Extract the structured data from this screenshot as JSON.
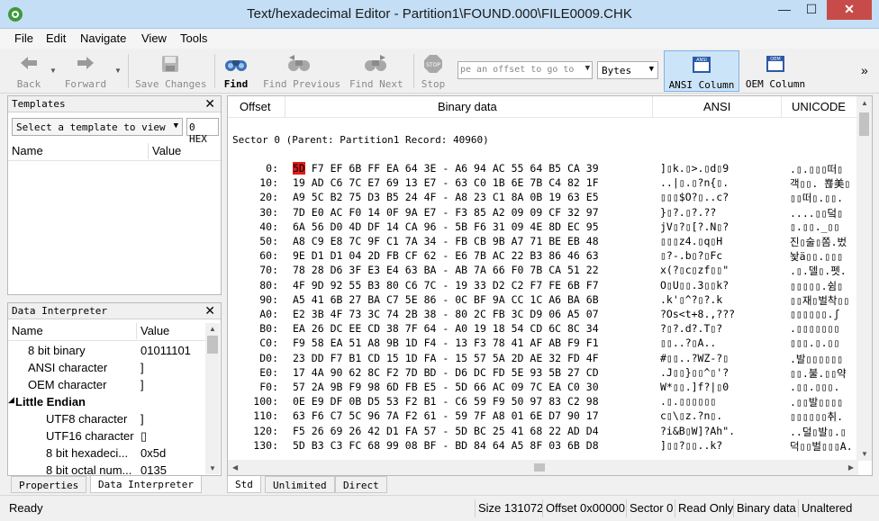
{
  "window": {
    "title": "Text/hexadecimal Editor - Partition1\\FOUND.000\\FILE0009.CHK",
    "minimize": "—",
    "maximize": "☐",
    "close": "✕"
  },
  "menu": [
    "File",
    "Edit",
    "Navigate",
    "View",
    "Tools"
  ],
  "toolbar": {
    "back": "Back",
    "forward": "Forward",
    "save_changes": "Save Changes",
    "find": "Find",
    "find_previous": "Find Previous",
    "find_next": "Find Next",
    "stop": "Stop",
    "offset_placeholder": "pe an offset to go to",
    "bytes_select": "Bytes",
    "ansi_column": "ANSI Column",
    "oem_column": "OEM Column",
    "overflow": "»"
  },
  "templates_pane": {
    "title": "Templates",
    "select_placeholder": "Select a template to view",
    "hex_value": "0 HEX",
    "col_name": "Name",
    "col_value": "Value"
  },
  "data_interpreter": {
    "title": "Data Interpreter",
    "col_name": "Name",
    "col_value": "Value",
    "rows": [
      {
        "name": "8 bit binary",
        "value": "01011101",
        "indent": 1
      },
      {
        "name": "ANSI character",
        "value": "]",
        "indent": 1
      },
      {
        "name": "OEM character",
        "value": "]",
        "indent": 1
      },
      {
        "name": "Little Endian",
        "value": "",
        "indent": 0,
        "group": true
      },
      {
        "name": "UTF8 character",
        "value": "]",
        "indent": 2
      },
      {
        "name": "UTF16 character",
        "value": "▯",
        "indent": 2
      },
      {
        "name": "8 bit hexadeci...",
        "value": "0x5d",
        "indent": 2
      },
      {
        "name": "8 bit octal num...",
        "value": "0135",
        "indent": 2
      }
    ]
  },
  "left_tabs": [
    "Properties",
    "Data Interpreter"
  ],
  "hex_view": {
    "col_offset": "Offset",
    "col_binary": "Binary data",
    "col_ansi": "ANSI",
    "col_unicode": "UNICODE",
    "sector_line": "Sector 0 (Parent: Partition1 Record: 40960)",
    "rows": [
      {
        "off": "0:",
        "b": [
          "5D",
          "F7",
          "EF",
          "6B",
          "FF",
          "EA",
          "64",
          "3E",
          "A6",
          "94",
          "AC",
          "55",
          "64",
          "B5",
          "CA",
          "39"
        ],
        "a": "]▯k.▯>.▯d▯9",
        "u": ".▯.▯▯▯떠▯"
      },
      {
        "off": "10:",
        "b": [
          "19",
          "AD",
          "C6",
          "7C",
          "E7",
          "69",
          "13",
          "E7",
          "63",
          "C0",
          "1B",
          "6E",
          "7B",
          "C4",
          "82",
          "1F"
        ],
        "a": "..|▯.▯?n{▯.",
        "u": "객▯▯. 뾶美▯"
      },
      {
        "off": "20:",
        "b": [
          "A9",
          "5C",
          "B2",
          "75",
          "D3",
          "B5",
          "24",
          "4F",
          "A8",
          "23",
          "C1",
          "8A",
          "0B",
          "19",
          "63",
          "E5"
        ],
        "a": "▯▯▯$O?▯..c?",
        "u": "▯▯떠▯.▯▯."
      },
      {
        "off": "30:",
        "b": [
          "7D",
          "E0",
          "AC",
          "F0",
          "14",
          "0F",
          "9A",
          "E7",
          "F3",
          "85",
          "A2",
          "09",
          "09",
          "CF",
          "32",
          "97"
        ],
        "a": "}▯?.▯?.??",
        "u": "....▯▯덬▯"
      },
      {
        "off": "40:",
        "b": [
          "6A",
          "56",
          "D0",
          "4D",
          "DF",
          "14",
          "CA",
          "96",
          "5B",
          "F6",
          "31",
          "09",
          "4E",
          "8D",
          "EC",
          "95"
        ],
        "a": "jV▯?▯[?.N▯?",
        "u": "▯.▯▯.̲▯▯"
      },
      {
        "off": "50:",
        "b": [
          "A8",
          "C9",
          "E8",
          "7C",
          "9F",
          "C1",
          "7A",
          "34",
          "FB",
          "CB",
          "9B",
          "A7",
          "71",
          "BE",
          "EB",
          "48"
        ],
        "a": "▯▯▯z4.▯q▯H",
        "u": "진▯술▯쫌.벘"
      },
      {
        "off": "60:",
        "b": [
          "9E",
          "D1",
          "D1",
          "04",
          "2D",
          "FB",
          "CF",
          "62",
          "E6",
          "7B",
          "AC",
          "22",
          "B3",
          "86",
          "46",
          "63"
        ],
        "a": "▯?-.b▯?▯Fc",
        "u": "놫ä▯▯.▯▯▯"
      },
      {
        "off": "70:",
        "b": [
          "78",
          "28",
          "D6",
          "3F",
          "E3",
          "E4",
          "63",
          "BA",
          "AB",
          "7A",
          "66",
          "F0",
          "7B",
          "CA",
          "51",
          "22"
        ],
        "a": "x(?▯c▯zf▯▯\"",
        "u": ".▯.델▯.펫."
      },
      {
        "off": "80:",
        "b": [
          "4F",
          "9D",
          "92",
          "55",
          "B3",
          "80",
          "C6",
          "7C",
          "19",
          "33",
          "D2",
          "C2",
          "F7",
          "FE",
          "6B",
          "F7"
        ],
        "a": "O▯U▯▯.3▯▯k?",
        "u": "▯▯▯▯▯.쉼▯"
      },
      {
        "off": "90:",
        "b": [
          "A5",
          "41",
          "6B",
          "27",
          "BA",
          "C7",
          "5E",
          "86",
          "0C",
          "BF",
          "9A",
          "CC",
          "1C",
          "A6",
          "BA",
          "6B"
        ],
        "a": ".k'▯^?▯?.k",
        "u": "▯▯재▯벌착▯▯"
      },
      {
        "off": "A0:",
        "b": [
          "E2",
          "3B",
          "4F",
          "73",
          "3C",
          "74",
          "2B",
          "38",
          "80",
          "2C",
          "FB",
          "3C",
          "D9",
          "06",
          "A5",
          "07"
        ],
        "a": "?Os<t+8.,???",
        "u": "▯▯▯▯▯▯.ʃ"
      },
      {
        "off": "B0:",
        "b": [
          "EA",
          "26",
          "DC",
          "EE",
          "CD",
          "38",
          "7F",
          "64",
          "A0",
          "19",
          "18",
          "54",
          "CD",
          "6C",
          "8C",
          "34"
        ],
        "a": "?▯?.d?.T▯?",
        "u": ".▯▯▯▯▯▯▯"
      },
      {
        "off": "C0:",
        "b": [
          "F9",
          "58",
          "EA",
          "51",
          "A8",
          "9B",
          "1D",
          "F4",
          "13",
          "F3",
          "78",
          "41",
          "AF",
          "AB",
          "F9",
          "F1"
        ],
        "a": "▯▯..?▯A..",
        "u": "▯▯▯.▯.▯▯"
      },
      {
        "off": "D0:",
        "b": [
          "23",
          "DD",
          "F7",
          "B1",
          "CD",
          "15",
          "1D",
          "FA",
          "15",
          "57",
          "5A",
          "2D",
          "AE",
          "32",
          "FD",
          "4F"
        ],
        "a": "#▯▯..?WZ-?▯",
        "u": ".발▯▯▯▯▯▯"
      },
      {
        "off": "E0:",
        "b": [
          "17",
          "4A",
          "90",
          "62",
          "8C",
          "F2",
          "7D",
          "BD",
          "D6",
          "DC",
          "FD",
          "5E",
          "93",
          "5B",
          "27",
          "CD"
        ],
        "a": ".J▯▯}▯▯^▯'?",
        "u": "▯▯.불.▯▯약"
      },
      {
        "off": "F0:",
        "b": [
          "57",
          "2A",
          "9B",
          "F9",
          "98",
          "6D",
          "FB",
          "E5",
          "5D",
          "66",
          "AC",
          "09",
          "7C",
          "EA",
          "C0",
          "30"
        ],
        "a": "W*▯▯.]f?|▯0",
        "u": ".▯▯.▯▯▯."
      },
      {
        "off": "100:",
        "b": [
          "0E",
          "E9",
          "DF",
          "0B",
          "D5",
          "53",
          "F2",
          "B1",
          "C6",
          "59",
          "F9",
          "50",
          "97",
          "83",
          "C2",
          "98"
        ],
        "a": ".▯.▯▯▯▯▯▯",
        "u": ".▯▯발▯▯▯▯"
      },
      {
        "off": "110:",
        "b": [
          "63",
          "F6",
          "C7",
          "5C",
          "96",
          "7A",
          "F2",
          "61",
          "59",
          "7F",
          "A8",
          "01",
          "6E",
          "D7",
          "90",
          "17"
        ],
        "a": "c▯\\▯z.?n▯.",
        "u": "▯▯▯▯▯▯취."
      },
      {
        "off": "120:",
        "b": [
          "F5",
          "26",
          "69",
          "26",
          "42",
          "D1",
          "FA",
          "57",
          "5D",
          "BC",
          "25",
          "41",
          "68",
          "22",
          "AD",
          "D4"
        ],
        "a": "?i&B▯W]?Ah\".",
        "u": "..덜▯발▯.▯"
      },
      {
        "off": "130:",
        "b": [
          "5D",
          "B3",
          "C3",
          "FC",
          "68",
          "99",
          "08",
          "BF",
          "BD",
          "84",
          "64",
          "A5",
          "8F",
          "03",
          "6B",
          "D8"
        ],
        "a": "]▯▯?▯▯..k?",
        "u": "덕▯▯벌▯▯▯Α."
      }
    ]
  },
  "right_tabs": [
    "Std",
    "Unlimited",
    "Direct"
  ],
  "status": {
    "ready": "Ready",
    "size": "Size 131072",
    "offset": "Offset 0x00000",
    "sector": "Sector 0",
    "mode": "Read Only",
    "datatype": "Binary data",
    "state": "Unaltered"
  }
}
